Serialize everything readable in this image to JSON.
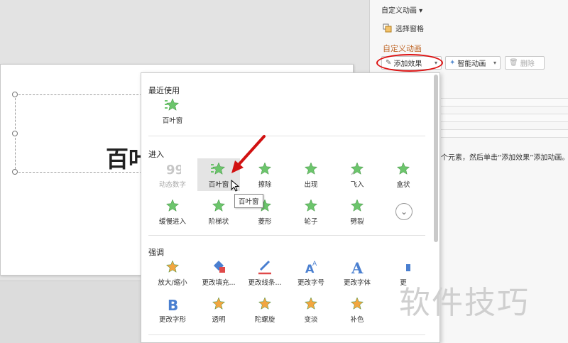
{
  "slide": {
    "title_text": "百叶"
  },
  "pane": {
    "header": "自定义动画 ▾",
    "select_pane_label": "选择窗格",
    "section_title": "自定义动画",
    "add_effect_label": "添加效果",
    "smart_anim_label": "智能动画",
    "delete_label": "删除",
    "hint_text": "个元素，然后单击“添加效果”添加动画。"
  },
  "menu": {
    "recent": {
      "title": "最近使用",
      "items": [
        {
          "label": "百叶窗",
          "icon": "star-green-blinds-icon"
        }
      ]
    },
    "entrance": {
      "title": "进入",
      "items": [
        {
          "label": "动态数字",
          "icon": "dynamic-number-icon",
          "disabled": true
        },
        {
          "label": "百叶窗",
          "icon": "star-green-blinds-icon"
        },
        {
          "label": "擦除",
          "icon": "star-green-wipe-icon"
        },
        {
          "label": "出现",
          "icon": "star-green-appear-icon"
        },
        {
          "label": "飞入",
          "icon": "star-green-fly-icon"
        },
        {
          "label": "盒状",
          "icon": "star-green-box-icon"
        },
        {
          "label": "缓慢进入",
          "icon": "star-green-slow-icon"
        },
        {
          "label": "阶梯状",
          "icon": "star-green-steps-icon"
        },
        {
          "label": "菱形",
          "icon": "star-green-diamond-icon"
        },
        {
          "label": "轮子",
          "icon": "star-green-wheel-icon"
        },
        {
          "label": "劈裂",
          "icon": "star-green-split-icon"
        }
      ]
    },
    "emphasis": {
      "title": "强调",
      "items": [
        {
          "label": "放大/缩小",
          "icon": "star-orange-grow-icon"
        },
        {
          "label": "更改填充...",
          "icon": "fill-bucket-icon"
        },
        {
          "label": "更改线条...",
          "icon": "line-pen-icon"
        },
        {
          "label": "更改字号",
          "icon": "font-size-icon"
        },
        {
          "label": "更改字体",
          "icon": "font-a-icon"
        },
        {
          "label": "更",
          "icon": "cut-off-icon"
        },
        {
          "label": "更改字形",
          "icon": "font-b-icon"
        },
        {
          "label": "透明",
          "icon": "star-orange-transparent-icon"
        },
        {
          "label": "陀螺旋",
          "icon": "star-orange-spin-icon"
        },
        {
          "label": "变淡",
          "icon": "star-orange-fade-icon"
        },
        {
          "label": "补色",
          "icon": "star-orange-complement-icon"
        }
      ]
    },
    "tooltip": "百叶窗"
  },
  "colors": {
    "green_star": "#6cc56c",
    "orange_star": "#f2a640",
    "accent": "#c0682a",
    "annotation_red": "#d11111"
  },
  "watermark": "软件技巧"
}
